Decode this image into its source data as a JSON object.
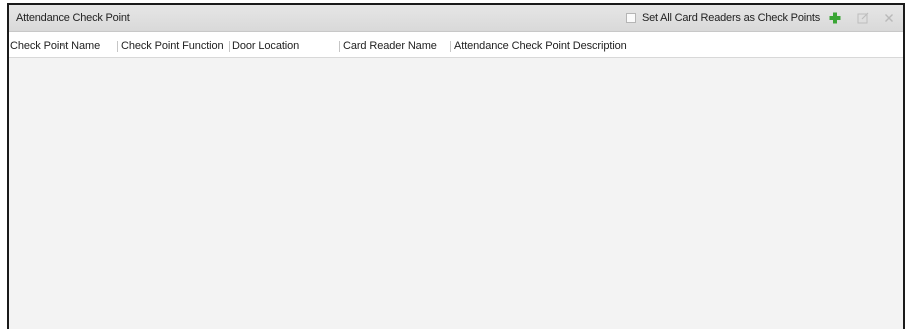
{
  "panel": {
    "title": "Attendance Check Point"
  },
  "toolbar": {
    "set_all_label": "Set All Card Readers as Check Points",
    "set_all_checked": false,
    "add_icon": "plus-icon",
    "edit_icon": "edit-icon",
    "delete_icon": "close-icon",
    "add_color": "#3aa535",
    "disabled_color": "#b9b9b9"
  },
  "table": {
    "columns": [
      {
        "label": "Check Point Name",
        "sorted": "ascending"
      },
      {
        "label": "Check Point Function"
      },
      {
        "label": "Door Location"
      },
      {
        "label": "Card Reader Name"
      },
      {
        "label": "Attendance Check Point Description"
      }
    ],
    "rows": []
  }
}
